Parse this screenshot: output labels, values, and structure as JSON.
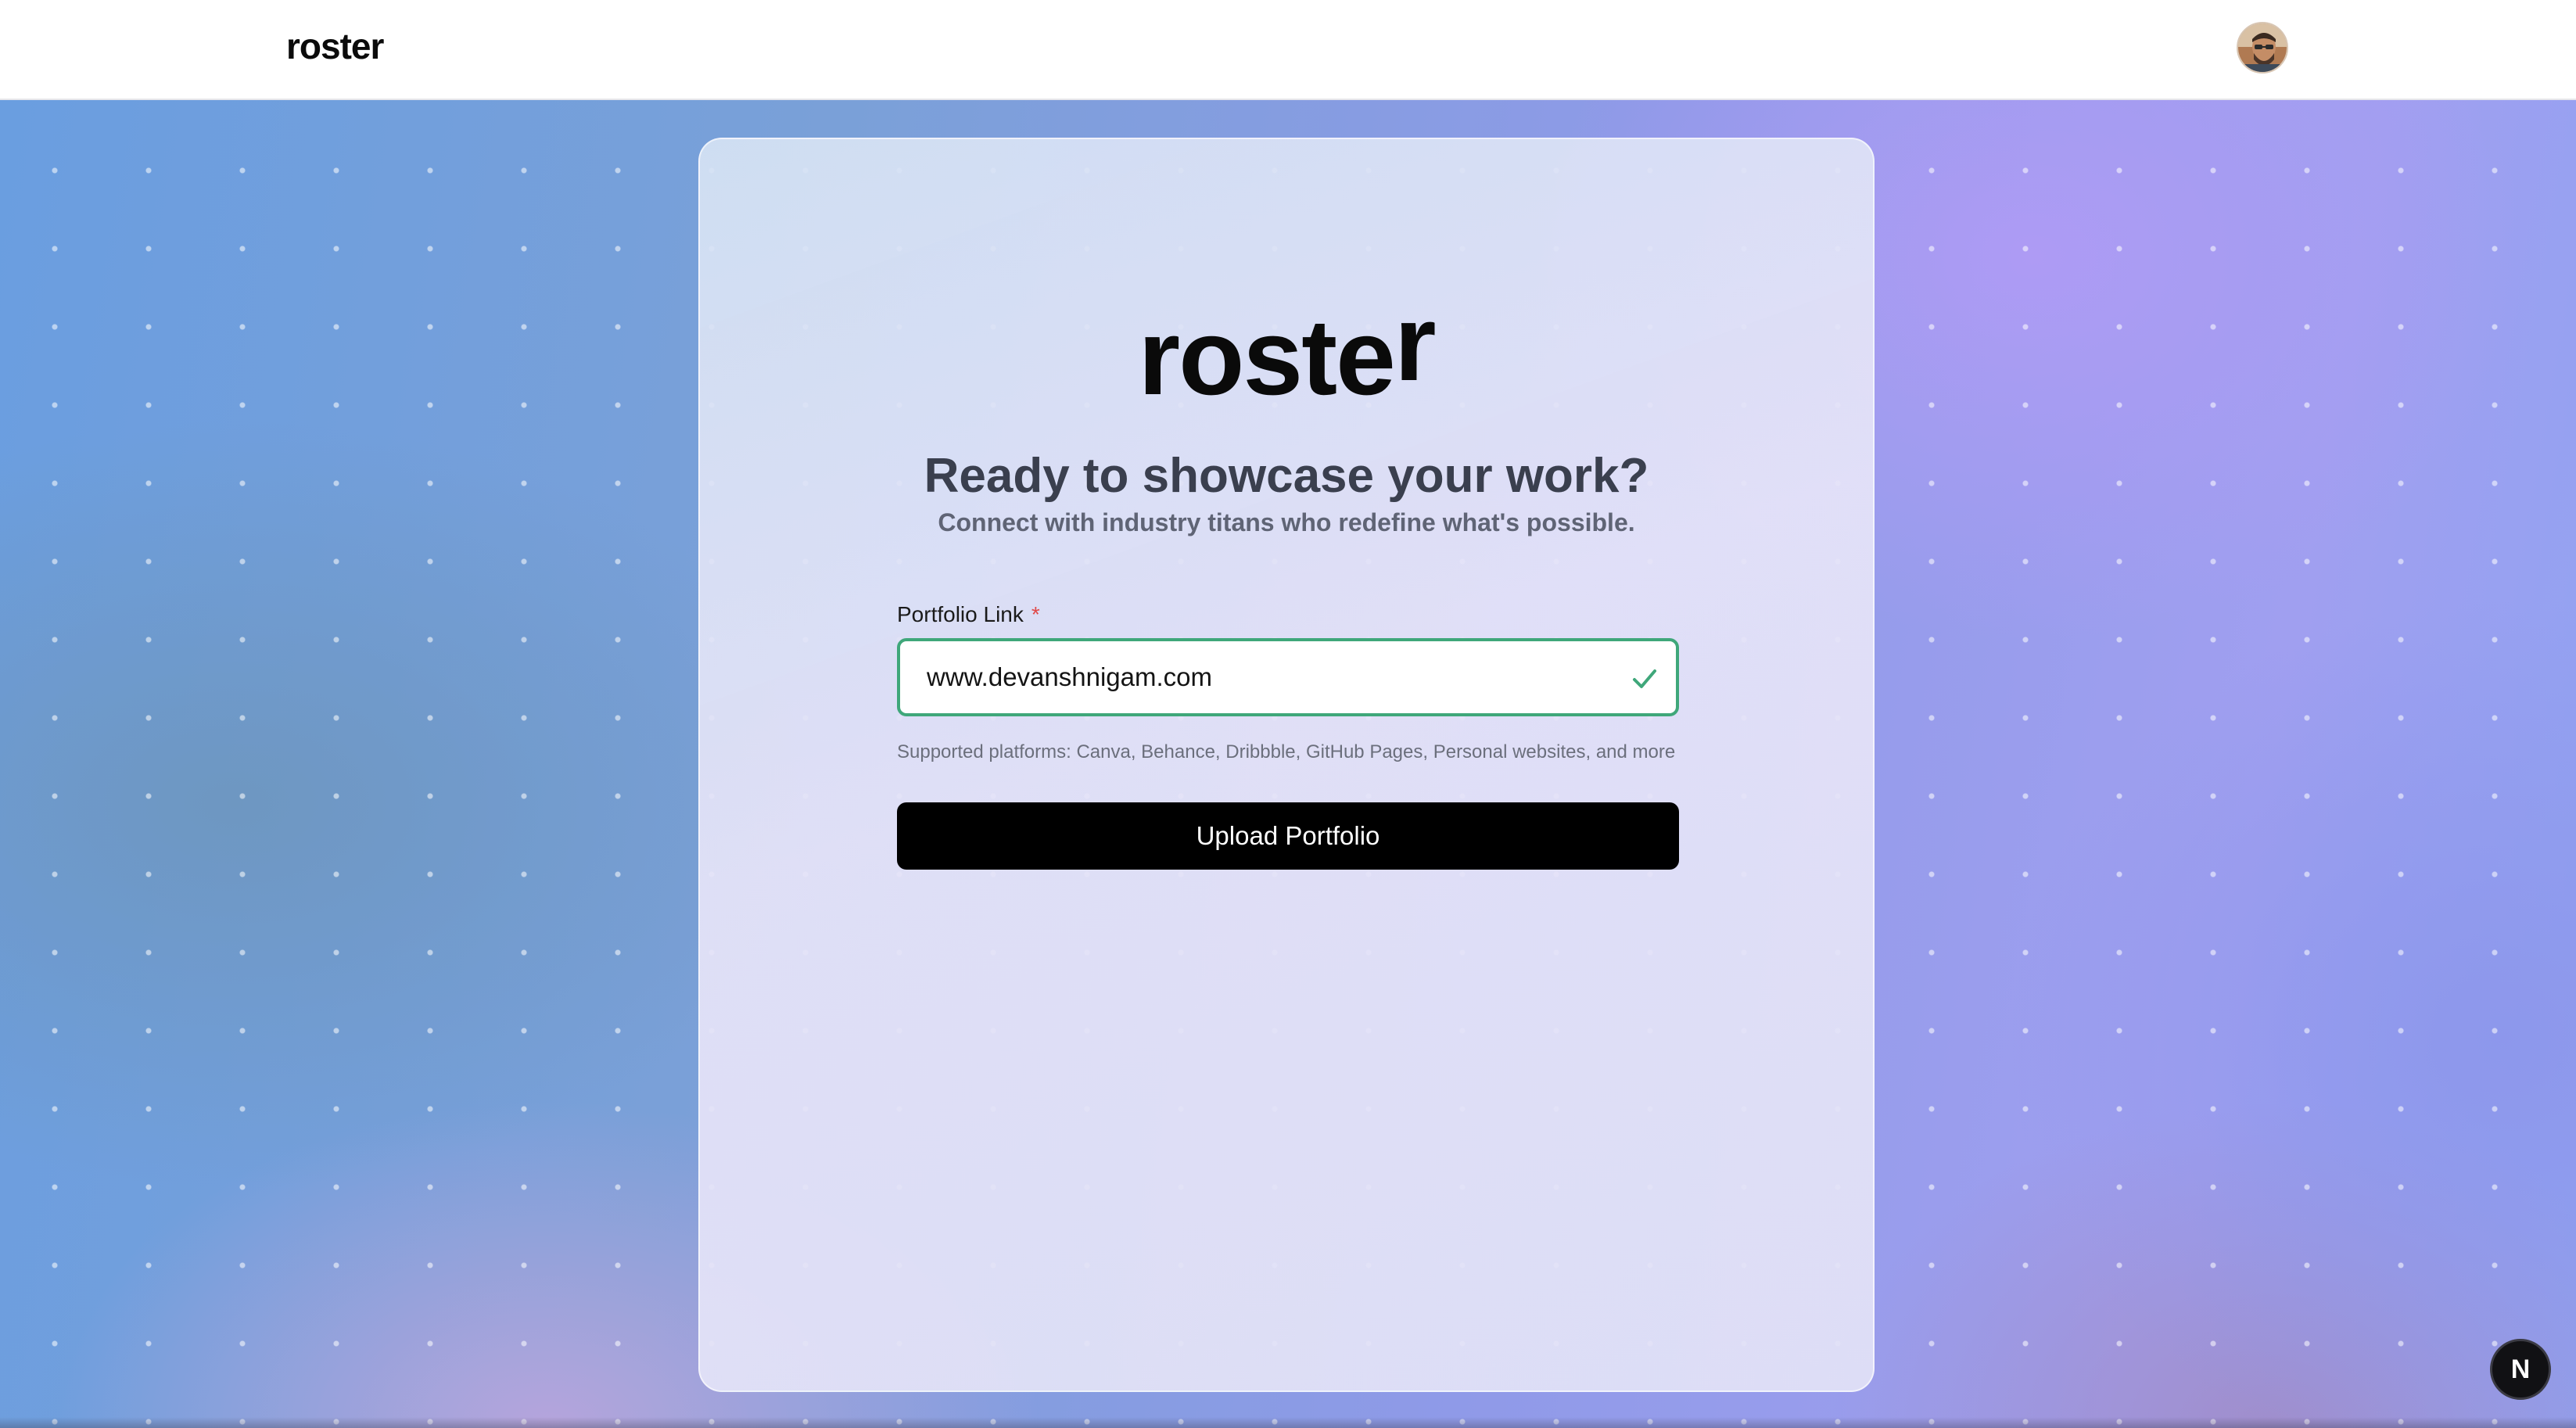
{
  "header": {
    "brand": "roster",
    "avatar_icon": "user-avatar"
  },
  "card": {
    "logo": "roster",
    "headline": "Ready to showcase your work?",
    "subheadline": "Connect with industry titans who redefine what's possible.",
    "portfolio_field": {
      "label": "Portfolio Link",
      "required_marker": "*",
      "value": "www.devanshnigam.com",
      "status_icon": "check-icon",
      "helper": "Supported platforms: Canva, Behance, Dribbble, GitHub Pages, Personal websites, and more"
    },
    "upload_button": "Upload Portfolio"
  },
  "floating_badge": {
    "label": "N"
  },
  "colors": {
    "valid_border": "#3fa77a",
    "button_bg": "#000000",
    "required": "#e04848"
  }
}
